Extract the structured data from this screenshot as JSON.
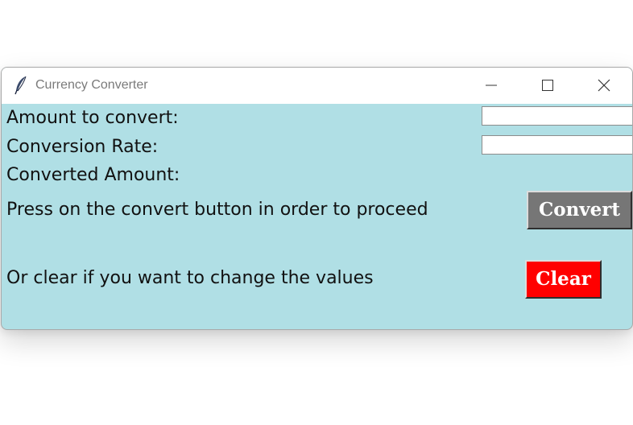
{
  "window": {
    "title": "Currency Converter",
    "icon": "feather-icon",
    "controls": {
      "minimize": "minimize-icon",
      "maximize": "maximize-icon",
      "close": "close-icon"
    }
  },
  "form": {
    "amount_label": "Amount to convert:",
    "amount_value": "",
    "rate_label": "Conversion Rate:",
    "rate_value": "",
    "converted_label": "Converted Amount:",
    "proceed_text": "Press on the convert button in order to proceed",
    "clear_text": "Or clear if you want to change the values"
  },
  "buttons": {
    "convert_label": "Convert",
    "clear_label": "Clear"
  },
  "colors": {
    "background": "#b0dfe5",
    "convert_button": "#767676",
    "clear_button": "#ff0000",
    "button_text": "#ffffff"
  }
}
